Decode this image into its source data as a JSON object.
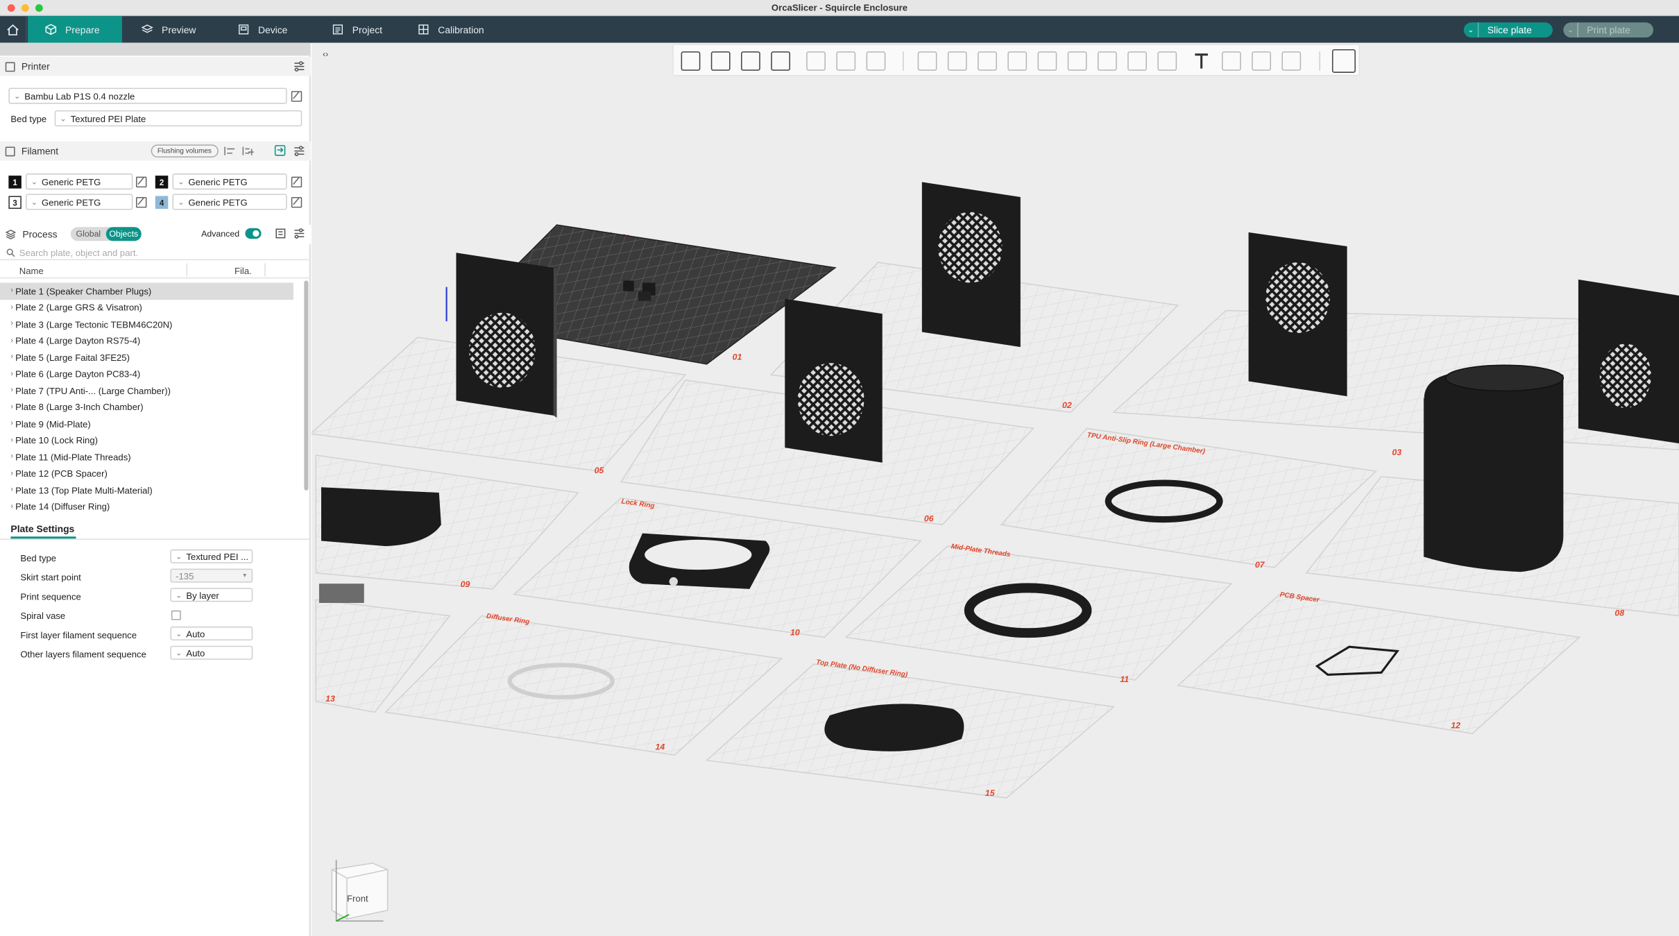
{
  "window": {
    "title": "OrcaSlicer - Squircle Enclosure"
  },
  "tabs": [
    {
      "label": "Prepare",
      "icon": "cube-icon",
      "active": true
    },
    {
      "label": "Preview",
      "icon": "layers-icon"
    },
    {
      "label": "Device",
      "icon": "device-icon"
    },
    {
      "label": "Project",
      "icon": "project-icon"
    },
    {
      "label": "Calibration",
      "icon": "calibration-icon"
    }
  ],
  "actions": {
    "slice": "Slice plate",
    "print": "Print plate"
  },
  "printer": {
    "header": "Printer",
    "value": "Bambu Lab P1S 0.4 nozzle",
    "bed_type_label": "Bed type",
    "bed_type": "Textured PEI Plate"
  },
  "filament": {
    "header": "Filament",
    "flushing": "Flushing volumes",
    "slots": [
      {
        "num": "1",
        "name": "Generic PETG",
        "color": "#111111"
      },
      {
        "num": "2",
        "name": "Generic PETG",
        "color": "#111111"
      },
      {
        "num": "3",
        "name": "Generic PETG",
        "color": "#ffffff"
      },
      {
        "num": "4",
        "name": "Generic PETG",
        "color": "#8fb8d8"
      }
    ]
  },
  "process": {
    "header": "Process",
    "global": "Global",
    "objects": "Objects",
    "advanced": "Advanced",
    "search_placeholder": "Search plate, object and part.",
    "col_name": "Name",
    "col_fila": "Fila."
  },
  "plates": [
    "Plate 1 (Speaker Chamber Plugs)",
    "Plate 2 (Large GRS & Visatron)",
    "Plate 3 (Large Tectonic TEBM46C20N)",
    "Plate 4 (Large Dayton RS75-4)",
    "Plate 5 (Large Faital 3FE25)",
    "Plate 6 (Large Dayton PC83-4)",
    "Plate 7 (TPU Anti-... (Large Chamber))",
    "Plate 8 (Large 3-Inch Chamber)",
    "Plate 9 (Mid-Plate)",
    "Plate 10 (Lock Ring)",
    "Plate 11 (Mid-Plate Threads)",
    "Plate 12 (PCB Spacer)",
    "Plate 13 (Top Plate Multi-Material)",
    "Plate 14 (Diffuser Ring)"
  ],
  "plate_settings": {
    "title": "Plate Settings",
    "rows": [
      {
        "label": "Bed type",
        "value": "Textured PEI ..."
      },
      {
        "label": "Skirt start point",
        "value": "-135"
      },
      {
        "label": "Print sequence",
        "value": "By layer"
      },
      {
        "label": "Spiral vase",
        "value": ""
      },
      {
        "label": "First layer filament sequence",
        "value": "Auto"
      },
      {
        "label": "Other layers filament sequence",
        "value": "Auto"
      }
    ]
  },
  "viewport": {
    "plate_numbers": [
      "01",
      "02",
      "03",
      "05",
      "06",
      "07",
      "08",
      "09",
      "10",
      "11",
      "12",
      "13",
      "14",
      "15"
    ],
    "plate_labels": [
      "Speaker Chamber Plugs",
      "TPU Anti-Slip Ring (Large Chamber)",
      "Lock Ring",
      "Mid-Plate Threads",
      "PCB Spacer",
      "Diffuser Ring",
      "Top Plate (No Diffuser Ring)"
    ],
    "navcube_face": "Front"
  },
  "colors": {
    "accent": "#0d9488",
    "tabbar": "#2c3e4a",
    "plate_label": "#e0452a"
  }
}
